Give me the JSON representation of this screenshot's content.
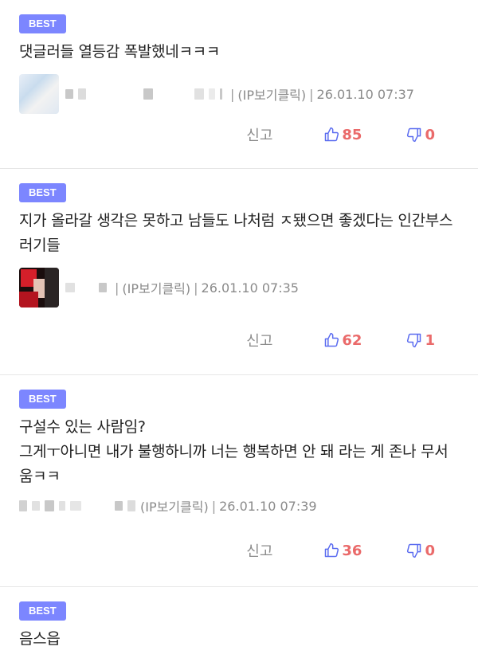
{
  "comments": [
    {
      "badge": "BEST",
      "text": "댓글러들 열등감 폭발했네ㅋㅋㅋ",
      "ip_link": "(IP보기클릭)",
      "timestamp": "26.01.10 07:37",
      "report_label": "신고",
      "likes": "85",
      "dislikes": "0"
    },
    {
      "badge": "BEST",
      "text": "지가 올라갈 생각은 못하고 남들도 나처럼 ㅈ됐으면 좋겠다는 인간부스러기들",
      "ip_link": "(IP보기클릭)",
      "timestamp": "26.01.10 07:35",
      "report_label": "신고",
      "likes": "62",
      "dislikes": "1"
    },
    {
      "badge": "BEST",
      "text_line1": "구설수 있는 사람임?",
      "text_line2": "그게ㅜ아니면 내가 불행하니까 너는 행복하면 안 돼 라는 게 존나 무서움ㅋㅋ",
      "ip_link": "(IP보기클릭)",
      "timestamp": "26.01.10 07:39",
      "report_label": "신고",
      "likes": "36",
      "dislikes": "0"
    },
    {
      "badge": "BEST",
      "text": "음스읍"
    }
  ],
  "colors": {
    "badge_bg": "#7c86ff",
    "like_color": "#ea6a6a",
    "like_icon": "#5b6cf0",
    "dislike_icon": "#5b6cf0"
  },
  "icons": {
    "like": "thumbs-up-icon",
    "dislike": "thumbs-down-icon"
  }
}
